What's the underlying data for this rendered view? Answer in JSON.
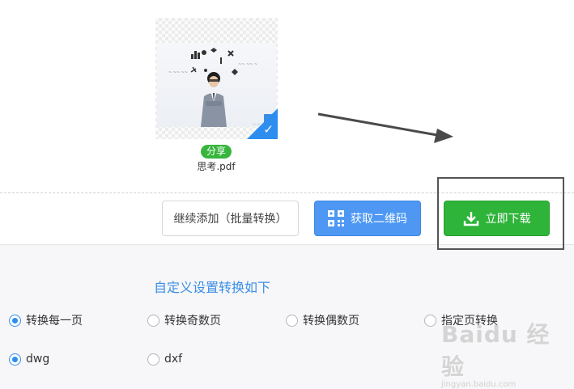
{
  "file": {
    "share_label": "分享",
    "name": "思考.pdf"
  },
  "actions": {
    "add_label": "继续添加（批量转换）",
    "qr_label": "获取二维码",
    "download_label": "立即下载"
  },
  "settings": {
    "title": "自定义设置转换如下",
    "page_options": [
      {
        "label": "转换每一页",
        "checked": true
      },
      {
        "label": "转换奇数页",
        "checked": false
      },
      {
        "label": "转换偶数页",
        "checked": false
      },
      {
        "label": "指定页转换",
        "checked": false
      }
    ],
    "format_options": [
      {
        "label": "dwg",
        "checked": true
      },
      {
        "label": "dxf",
        "checked": false
      }
    ]
  },
  "watermark": {
    "brand": "Baidu 经验",
    "url": "jingyan.baidu.com"
  },
  "colors": {
    "accent_blue": "#2e8ef0",
    "qr_button": "#4e98f4",
    "download_button": "#2fb43a",
    "share_badge": "#37b53c",
    "settings_title": "#3a8ee6"
  },
  "icons": [
    "check-icon",
    "qr-code-icon",
    "download-icon",
    "radio-button"
  ]
}
